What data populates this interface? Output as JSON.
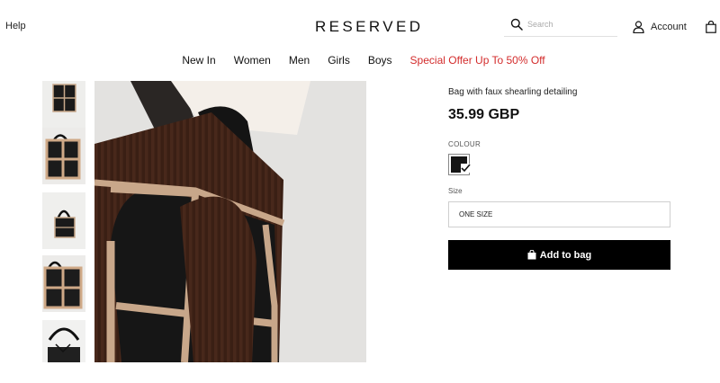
{
  "header": {
    "help_label": "Help",
    "logo_text": "RESERVED",
    "search_placeholder": "Search",
    "account_label": "Account"
  },
  "nav": {
    "items": [
      "New In",
      "Women",
      "Men",
      "Girls",
      "Boys"
    ],
    "special_offer": "Special Offer Up To 50% Off",
    "special_color": "#d32c2c"
  },
  "product": {
    "title": "Bag with faux shearling detailing",
    "price": "35.99 GBP",
    "colour_label": "COLOUR",
    "selected_colour": "#151515",
    "size_label": "Size",
    "size_value": "ONE SIZE",
    "add_to_bag_label": "Add to bag"
  },
  "gallery": {
    "thumbnail_count": 5,
    "scroll_icon": "chevron-down-icon"
  },
  "icons": {
    "search": "search-icon",
    "account": "user-icon",
    "bag": "shopping-bag-icon",
    "add_to_bag": "bag-icon"
  }
}
